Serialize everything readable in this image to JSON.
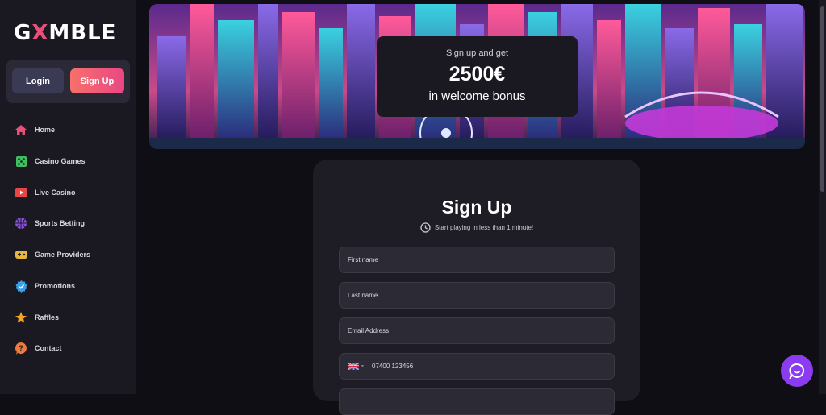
{
  "brand": {
    "logo_pre": "G",
    "logo_x": "X",
    "logo_post": "MBLE"
  },
  "auth": {
    "login_label": "Login",
    "signup_label": "Sign Up"
  },
  "nav": [
    {
      "label": "Home",
      "icon": "home-icon",
      "color": "#e94f7a"
    },
    {
      "label": "Casino Games",
      "icon": "dice-icon",
      "color": "#3fbf5f"
    },
    {
      "label": "Live Casino",
      "icon": "play-icon",
      "color": "#e84545"
    },
    {
      "label": "Sports Betting",
      "icon": "basketball-icon",
      "color": "#8a4fe0"
    },
    {
      "label": "Game Providers",
      "icon": "gamepad-icon",
      "color": "#e8b53a"
    },
    {
      "label": "Promotions",
      "icon": "badge-check-icon",
      "color": "#3aa0e8"
    },
    {
      "label": "Raffles",
      "icon": "star-icon",
      "color": "#f5a623"
    },
    {
      "label": "Contact",
      "icon": "help-icon",
      "color": "#f07a3a"
    }
  ],
  "promo": {
    "line1": "Sign up and get",
    "amount": "2500€",
    "line3": "in welcome bonus"
  },
  "signup": {
    "title": "Sign Up",
    "subtitle": "Start playing in less than 1 minute!",
    "first_name_placeholder": "First name",
    "last_name_placeholder": "Last name",
    "email_placeholder": "Email Address",
    "phone_placeholder": "07400 123456"
  },
  "colors": {
    "accent": "#e94784",
    "chat": "#8b3cf0"
  }
}
